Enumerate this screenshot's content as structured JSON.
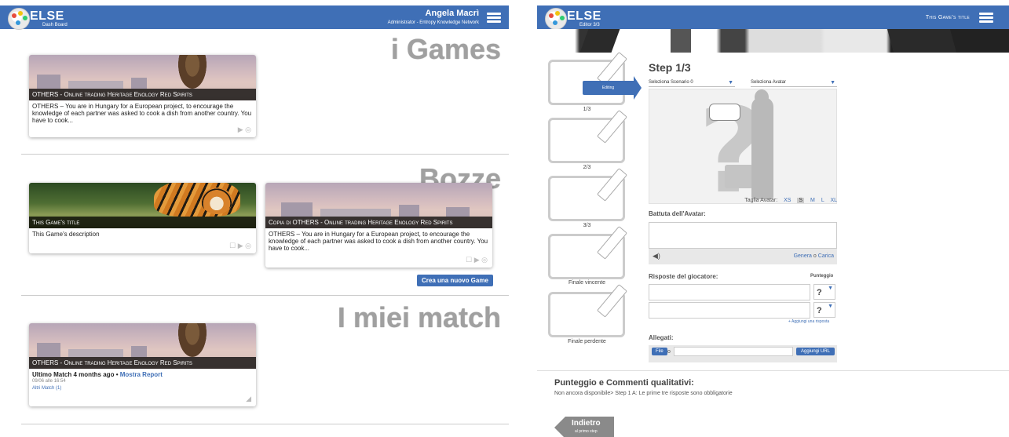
{
  "left_panel": {
    "app_name": "ELSE",
    "app_subtitle": "Dash Board",
    "user_name": "Angela Macrì",
    "user_role": "Administrator - Entropy Knowledge Network",
    "sections": {
      "games_title": "i Games",
      "bozze_title": "Bozze",
      "match_title": "I miei match"
    },
    "games": [
      {
        "title": "OTHERS - Online trading Heritage Enology Red Spirits",
        "description": "OTHERS – You are in Hungary for a European project, to encourage the knowledge of each partner was asked to cook a dish from another country. You have to cook...",
        "icons": "▶ ◎"
      }
    ],
    "bozze": [
      {
        "title": "This Game's title",
        "description": "This Game's description",
        "icons": "☐ ▶ ◎"
      },
      {
        "title": "Copia di OTHERS - Online trading Heritage Enology Red Spirits",
        "description": "OTHERS – You are in Hungary for a European project, to encourage the knowledge of each partner was asked to cook a dish from another country. You have to cook...",
        "icons": "☐ ▶ ◎"
      }
    ],
    "create_button": "Crea una nuovo Game",
    "match": {
      "title": "OTHERS - Online trading Heritage Enology Red Spirits",
      "last_match_prefix": "Ultimo Match 4 months ago",
      "report_link": "Mostra Report",
      "date": "09/06 alle 16:54",
      "other_matches": "Altri Match (1)",
      "icon": "◢"
    }
  },
  "right_panel": {
    "app_name": "ELSE",
    "app_subtitle": "Editor 3/3",
    "game_title": "This Game's title",
    "step_heading": "Step 1/3",
    "editing_label": "Editing",
    "steps": [
      "1/3",
      "2/3",
      "3/3",
      "Finale vincente",
      "Finale perdente"
    ],
    "scenario_select": "Seleziona Scenario 0",
    "avatar_select": "Seleziona Avatar",
    "size_label": "Taglia Avatar:",
    "sizes": [
      "XS",
      "S",
      "M",
      "L",
      "XL"
    ],
    "avatar_line_label": "Battuta dell'Avatar:",
    "genera": "Genera",
    "o_text": "o",
    "carica": "Carica",
    "responses_label": "Risposte del giocatore:",
    "score_label": "Punteggio",
    "score_values": [
      "?",
      "?"
    ],
    "add_response": "+ Aggiungi una risposta",
    "attachments_label": "Allegati:",
    "file_button": "File",
    "url_button": "Aggiungi URL",
    "comments_title": "Punteggio e Commenti qualitativi:",
    "comments_text": "Non ancora disponibile> Step 1 A: Le prime tre risposte sono obbligatorie",
    "back_label": "Indietro",
    "back_sub": "al primo step"
  },
  "colors": {
    "header_blue": "#3f6fb6",
    "section_gray": "#a0a0a0"
  }
}
